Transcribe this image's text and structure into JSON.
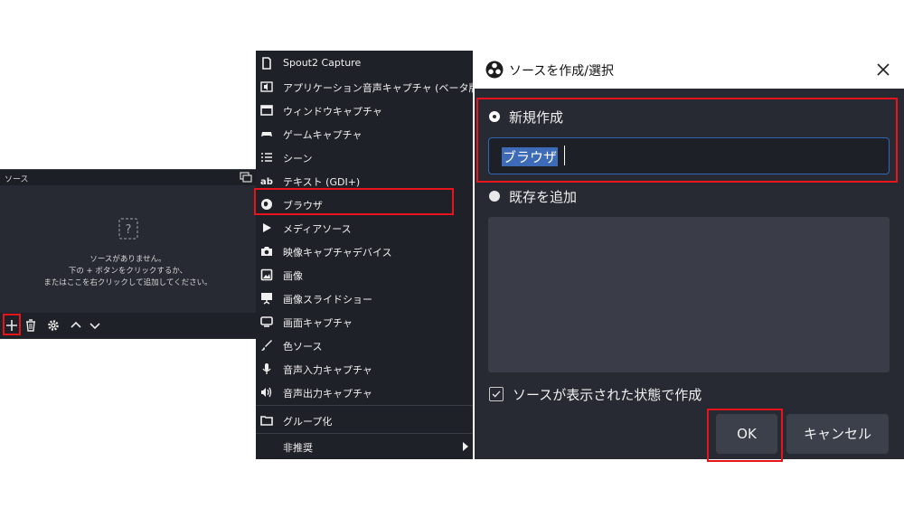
{
  "sources_panel": {
    "title": "ソース",
    "empty_lines": [
      "ソースがありません。",
      "下の + ボタンをクリックするか、",
      "またはここを右クリックして追加してください。"
    ],
    "toolbar_icons": [
      "plus-icon",
      "trash-icon",
      "gear-icon",
      "chevron-up-icon",
      "chevron-down-icon"
    ]
  },
  "menu": {
    "items": [
      {
        "label": "Spout2 Capture",
        "icon": "file-icon"
      },
      {
        "label": "アプリケーション音声キャプチャ (ベータ版)",
        "icon": "app-audio-icon"
      },
      {
        "label": "ウィンドウキャプチャ",
        "icon": "window-icon"
      },
      {
        "label": "ゲームキャプチャ",
        "icon": "gamepad-icon"
      },
      {
        "label": "シーン",
        "icon": "list-icon"
      },
      {
        "label": "テキスト (GDI+)",
        "icon": "text-icon"
      },
      {
        "label": "ブラウザ",
        "icon": "globe-icon"
      },
      {
        "label": "メディアソース",
        "icon": "play-icon"
      },
      {
        "label": "映像キャプチャデバイス",
        "icon": "camera-icon"
      },
      {
        "label": "画像",
        "icon": "image-icon"
      },
      {
        "label": "画像スライドショー",
        "icon": "slideshow-icon"
      },
      {
        "label": "画面キャプチャ",
        "icon": "monitor-icon"
      },
      {
        "label": "色ソース",
        "icon": "brush-icon"
      },
      {
        "label": "音声入力キャプチャ",
        "icon": "microphone-icon"
      },
      {
        "label": "音声出力キャプチャ",
        "icon": "speaker-icon"
      },
      {
        "label": "グループ化",
        "icon": "folder-icon"
      },
      {
        "label": "非推奨",
        "icon": ""
      }
    ]
  },
  "dialog": {
    "title": "ソースを作成/選択",
    "new_label": "新規作成",
    "name_value": "ブラウザ",
    "existing_label": "既存を追加",
    "visible_label": "ソースが表示された状態で作成",
    "ok_label": "OK",
    "cancel_label": "キャンセル"
  },
  "colors": {
    "highlight": "#e8141c",
    "panel_bg": "#272a33",
    "menu_bg": "#1f2128",
    "selection": "#3d6bb8"
  }
}
